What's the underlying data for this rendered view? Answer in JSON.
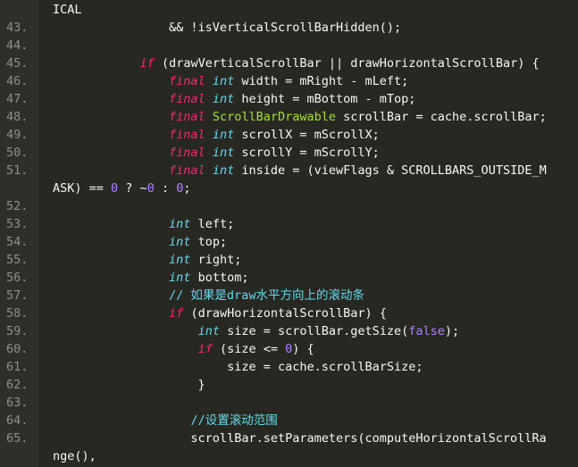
{
  "lines": [
    {
      "n": "",
      "tokens": [
        {
          "t": "ICAL",
          "c": "op"
        }
      ]
    },
    {
      "n": "43.",
      "tokens": [
        {
          "t": "                && !isVerticalScrollBarHidden();",
          "c": "op"
        }
      ]
    },
    {
      "n": "44.",
      "tokens": []
    },
    {
      "n": "45.",
      "tokens": [
        {
          "t": "            ",
          "c": "op"
        },
        {
          "t": "if",
          "c": "kw"
        },
        {
          "t": " (drawVerticalScrollBar || drawHorizontalScrollBar) {",
          "c": "op"
        }
      ]
    },
    {
      "n": "46.",
      "tokens": [
        {
          "t": "                ",
          "c": "op"
        },
        {
          "t": "final",
          "c": "kw"
        },
        {
          "t": " ",
          "c": "op"
        },
        {
          "t": "int",
          "c": "type"
        },
        {
          "t": " width = mRight - mLeft;",
          "c": "op"
        }
      ]
    },
    {
      "n": "47.",
      "tokens": [
        {
          "t": "                ",
          "c": "op"
        },
        {
          "t": "final",
          "c": "kw"
        },
        {
          "t": " ",
          "c": "op"
        },
        {
          "t": "int",
          "c": "type"
        },
        {
          "t": " height = mBottom - mTop;",
          "c": "op"
        }
      ]
    },
    {
      "n": "48.",
      "tokens": [
        {
          "t": "                ",
          "c": "op"
        },
        {
          "t": "final",
          "c": "kw"
        },
        {
          "t": " ",
          "c": "op"
        },
        {
          "t": "ScrollBarDrawable",
          "c": "cls"
        },
        {
          "t": " scrollBar = cache.scrollBar;",
          "c": "op"
        }
      ]
    },
    {
      "n": "49.",
      "tokens": [
        {
          "t": "                ",
          "c": "op"
        },
        {
          "t": "final",
          "c": "kw"
        },
        {
          "t": " ",
          "c": "op"
        },
        {
          "t": "int",
          "c": "type"
        },
        {
          "t": " scrollX = mScrollX;",
          "c": "op"
        }
      ]
    },
    {
      "n": "50.",
      "tokens": [
        {
          "t": "                ",
          "c": "op"
        },
        {
          "t": "final",
          "c": "kw"
        },
        {
          "t": " ",
          "c": "op"
        },
        {
          "t": "int",
          "c": "type"
        },
        {
          "t": " scrollY = mScrollY;",
          "c": "op"
        }
      ]
    },
    {
      "n": "51.",
      "tokens": [
        {
          "t": "                ",
          "c": "op"
        },
        {
          "t": "final",
          "c": "kw"
        },
        {
          "t": " ",
          "c": "op"
        },
        {
          "t": "int",
          "c": "type"
        },
        {
          "t": " inside = (viewFlags & SCROLLBARS_OUTSIDE_M",
          "c": "op"
        }
      ]
    },
    {
      "n": "",
      "tokens": [
        {
          "t": "ASK) == ",
          "c": "op"
        },
        {
          "t": "0",
          "c": "num"
        },
        {
          "t": " ? ~",
          "c": "op"
        },
        {
          "t": "0",
          "c": "num"
        },
        {
          "t": " : ",
          "c": "op"
        },
        {
          "t": "0",
          "c": "num"
        },
        {
          "t": ";",
          "c": "op"
        }
      ]
    },
    {
      "n": "52.",
      "tokens": []
    },
    {
      "n": "53.",
      "tokens": [
        {
          "t": "                ",
          "c": "op"
        },
        {
          "t": "int",
          "c": "type"
        },
        {
          "t": " left;",
          "c": "op"
        }
      ]
    },
    {
      "n": "54.",
      "tokens": [
        {
          "t": "                ",
          "c": "op"
        },
        {
          "t": "int",
          "c": "type"
        },
        {
          "t": " top;",
          "c": "op"
        }
      ]
    },
    {
      "n": "55.",
      "tokens": [
        {
          "t": "                ",
          "c": "op"
        },
        {
          "t": "int",
          "c": "type"
        },
        {
          "t": " right;",
          "c": "op"
        }
      ]
    },
    {
      "n": "56.",
      "tokens": [
        {
          "t": "                ",
          "c": "op"
        },
        {
          "t": "int",
          "c": "type"
        },
        {
          "t": " bottom;",
          "c": "op"
        }
      ]
    },
    {
      "n": "57.",
      "tokens": [
        {
          "t": "                ",
          "c": "op"
        },
        {
          "t": "// 如果是draw水平方向上的滚动条",
          "c": "cm-cn"
        }
      ]
    },
    {
      "n": "58.",
      "tokens": [
        {
          "t": "                ",
          "c": "op"
        },
        {
          "t": "if",
          "c": "kw"
        },
        {
          "t": " (drawHorizontalScrollBar) {",
          "c": "op"
        }
      ]
    },
    {
      "n": "59.",
      "tokens": [
        {
          "t": "                    ",
          "c": "op"
        },
        {
          "t": "int",
          "c": "type"
        },
        {
          "t": " size = scrollBar.getSize(",
          "c": "op"
        },
        {
          "t": "false",
          "c": "num"
        },
        {
          "t": ");",
          "c": "op"
        }
      ]
    },
    {
      "n": "60.",
      "tokens": [
        {
          "t": "                    ",
          "c": "op"
        },
        {
          "t": "if",
          "c": "kw"
        },
        {
          "t": " (size <= ",
          "c": "op"
        },
        {
          "t": "0",
          "c": "num"
        },
        {
          "t": ") {",
          "c": "op"
        }
      ]
    },
    {
      "n": "61.",
      "tokens": [
        {
          "t": "                        size = cache.scrollBarSize;",
          "c": "op"
        }
      ]
    },
    {
      "n": "62.",
      "tokens": [
        {
          "t": "                    }",
          "c": "op"
        }
      ]
    },
    {
      "n": "63.",
      "tokens": []
    },
    {
      "n": "64.",
      "tokens": [
        {
          "t": "                   ",
          "c": "op"
        },
        {
          "t": "//设置滚动范围",
          "c": "cm-cn"
        }
      ]
    },
    {
      "n": "65.",
      "tokens": [
        {
          "t": "                   scrollBar.setParameters(computeHorizontalScrollRa",
          "c": "op"
        }
      ]
    },
    {
      "n": "",
      "tokens": [
        {
          "t": "nge(),",
          "c": "op"
        }
      ]
    }
  ]
}
